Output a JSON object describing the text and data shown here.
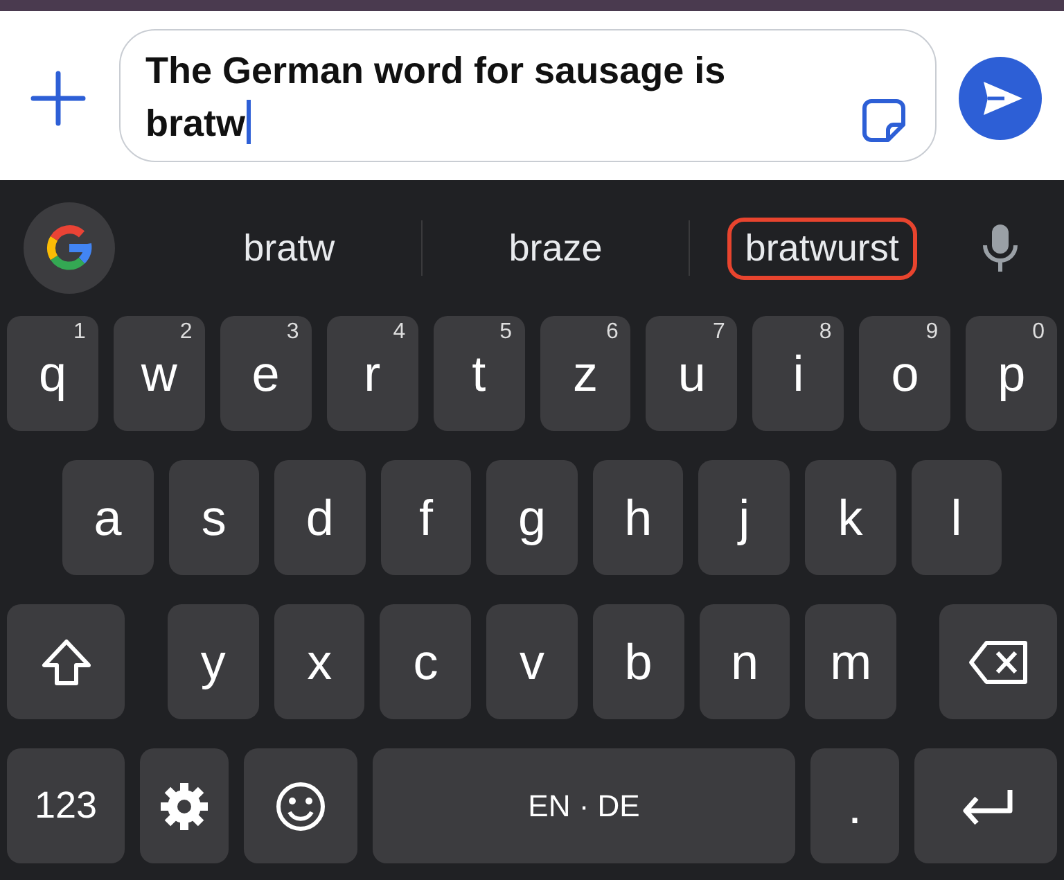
{
  "composer": {
    "text": "The German word for sausage is bratw"
  },
  "suggestions": [
    {
      "label": "bratw",
      "highlighted": false
    },
    {
      "label": "braze",
      "highlighted": false
    },
    {
      "label": "bratwurst",
      "highlighted": true
    }
  ],
  "keyboard": {
    "rows": [
      {
        "keys": [
          {
            "kind": "char",
            "label": "q",
            "hint": "1"
          },
          {
            "kind": "char",
            "label": "w",
            "hint": "2"
          },
          {
            "kind": "char",
            "label": "e",
            "hint": "3"
          },
          {
            "kind": "char",
            "label": "r",
            "hint": "4"
          },
          {
            "kind": "char",
            "label": "t",
            "hint": "5"
          },
          {
            "kind": "char",
            "label": "z",
            "hint": "6"
          },
          {
            "kind": "char",
            "label": "u",
            "hint": "7"
          },
          {
            "kind": "char",
            "label": "i",
            "hint": "8"
          },
          {
            "kind": "char",
            "label": "o",
            "hint": "9"
          },
          {
            "kind": "char",
            "label": "p",
            "hint": "0"
          }
        ]
      },
      {
        "keys": [
          {
            "kind": "char",
            "label": "a"
          },
          {
            "kind": "char",
            "label": "s"
          },
          {
            "kind": "char",
            "label": "d"
          },
          {
            "kind": "char",
            "label": "f"
          },
          {
            "kind": "char",
            "label": "g"
          },
          {
            "kind": "char",
            "label": "h"
          },
          {
            "kind": "char",
            "label": "j"
          },
          {
            "kind": "char",
            "label": "k"
          },
          {
            "kind": "char",
            "label": "l"
          }
        ]
      },
      {
        "keys": [
          {
            "kind": "shift"
          },
          {
            "kind": "char",
            "label": "y"
          },
          {
            "kind": "char",
            "label": "x"
          },
          {
            "kind": "char",
            "label": "c"
          },
          {
            "kind": "char",
            "label": "v"
          },
          {
            "kind": "char",
            "label": "b"
          },
          {
            "kind": "char",
            "label": "n"
          },
          {
            "kind": "char",
            "label": "m"
          },
          {
            "kind": "backspace"
          }
        ]
      },
      {
        "keys": [
          {
            "kind": "mode",
            "label": "123"
          },
          {
            "kind": "settings"
          },
          {
            "kind": "emoji"
          },
          {
            "kind": "space",
            "label": "EN · DE"
          },
          {
            "kind": "char",
            "label": "."
          },
          {
            "kind": "enter"
          }
        ]
      }
    ]
  }
}
